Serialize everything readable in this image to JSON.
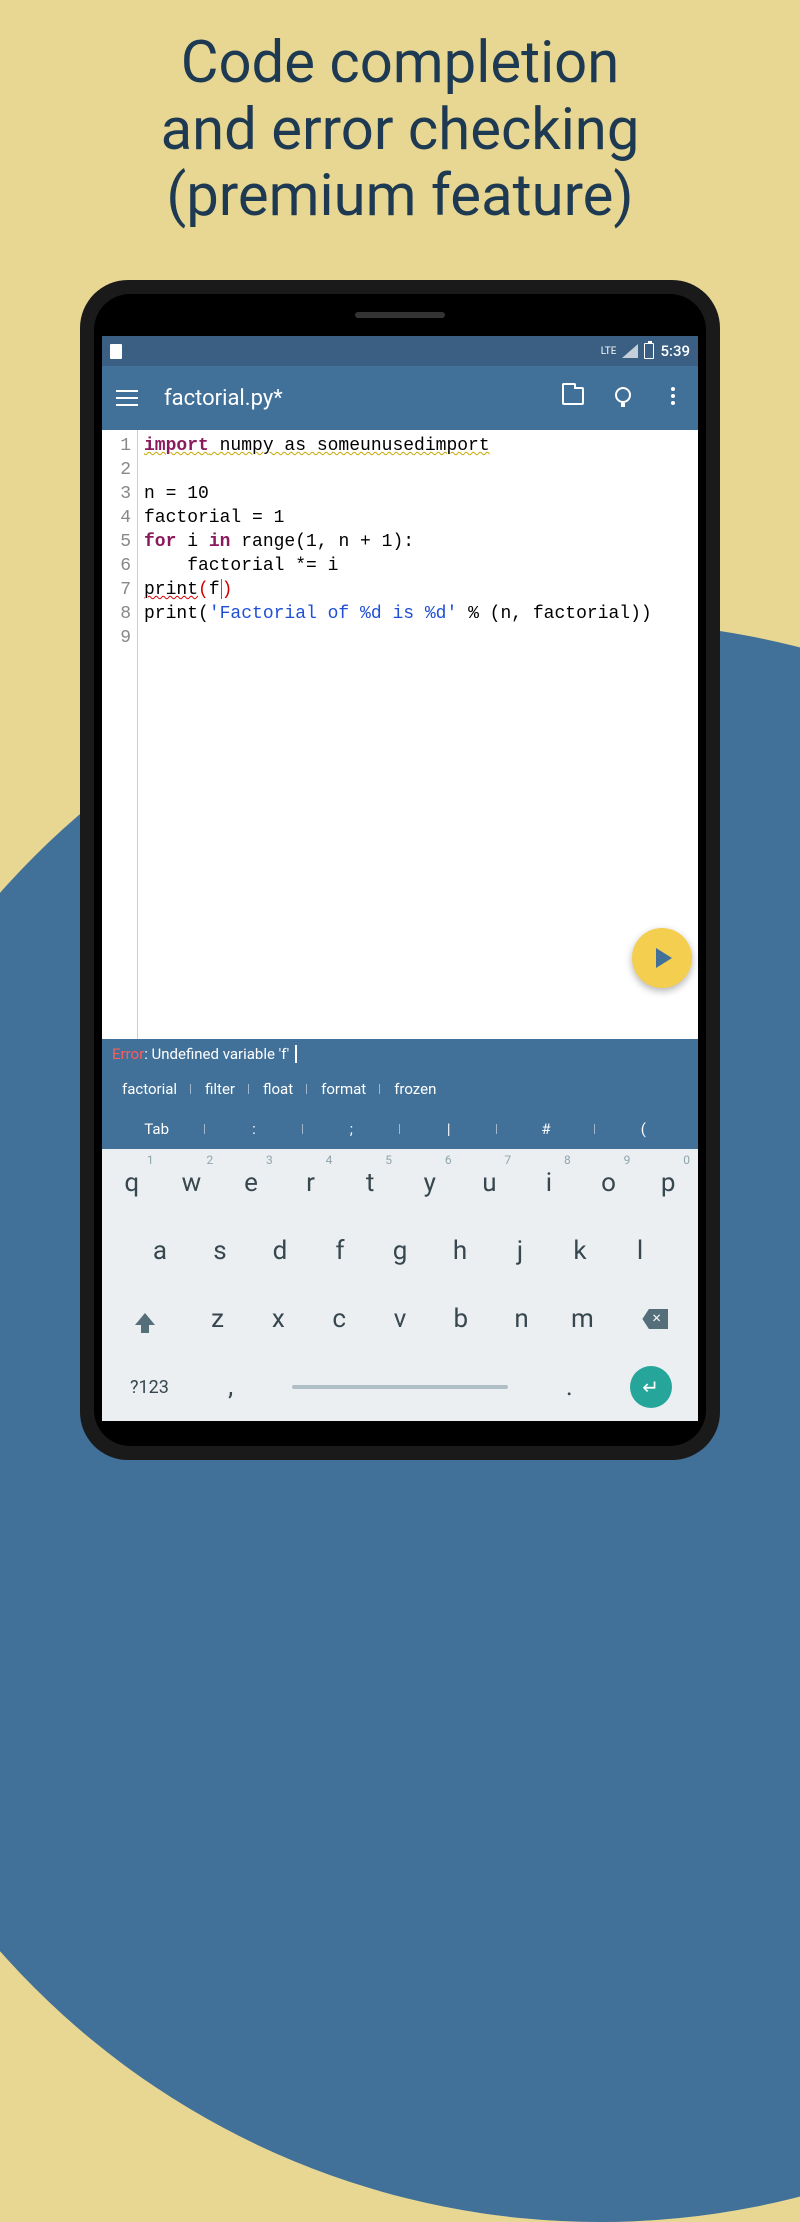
{
  "headline": "Code completion\nand error checking\n(premium feature)",
  "status": {
    "lte": "LTE",
    "time": "5:39"
  },
  "appbar": {
    "title": "factorial.py*"
  },
  "code": {
    "lines": [
      "1",
      "2",
      "3",
      "4",
      "5",
      "6",
      "7",
      "8",
      "9"
    ],
    "l1_import": "import",
    "l1_rest": " numpy as someunusedimport",
    "l3": "n = 10",
    "l4": "factorial = 1",
    "l5_for": "for",
    "l5_mid": " i ",
    "l5_in": "in",
    "l5_rest": " range(1, n + 1):",
    "l6": "    factorial *= i",
    "l7_print": "print",
    "l7_open": "(",
    "l7_f": "f",
    "l7_close": ")",
    "l8_a": "print(",
    "l8_str": "'Factorial of %d is %d'",
    "l8_b": " % (n, factorial))"
  },
  "error": {
    "label": "Error",
    "msg": " : Undefined variable 'f'"
  },
  "suggestions": [
    "factorial",
    "filter",
    "float",
    "format",
    "frozen"
  ],
  "symbols": [
    "Tab",
    ":",
    ";",
    "|",
    "#",
    "("
  ],
  "keyboard": {
    "row1": [
      {
        "k": "q",
        "h": "1"
      },
      {
        "k": "w",
        "h": "2"
      },
      {
        "k": "e",
        "h": "3"
      },
      {
        "k": "r",
        "h": "4"
      },
      {
        "k": "t",
        "h": "5"
      },
      {
        "k": "y",
        "h": "6"
      },
      {
        "k": "u",
        "h": "7"
      },
      {
        "k": "i",
        "h": "8"
      },
      {
        "k": "o",
        "h": "9"
      },
      {
        "k": "p",
        "h": "0"
      }
    ],
    "row2": [
      "a",
      "s",
      "d",
      "f",
      "g",
      "h",
      "j",
      "k",
      "l"
    ],
    "row3": [
      "z",
      "x",
      "c",
      "v",
      "b",
      "n",
      "m"
    ],
    "sym": "?123",
    "comma": ",",
    "period": "."
  }
}
